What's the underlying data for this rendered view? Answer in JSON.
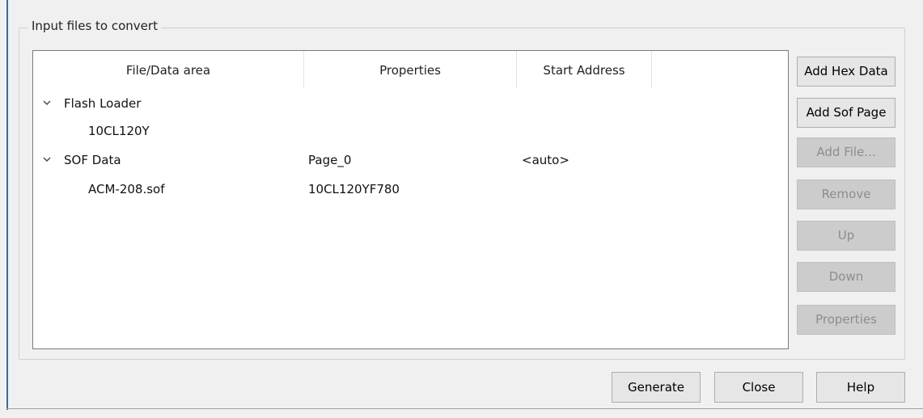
{
  "group": {
    "title": "Input files to convert"
  },
  "tree": {
    "columns": [
      "File/Data area",
      "Properties",
      "Start Address"
    ],
    "rows": [
      {
        "name": "Flash Loader",
        "properties": "",
        "start_address": "",
        "expander": "⌄",
        "level": 0
      },
      {
        "name": "10CL120Y",
        "properties": "",
        "start_address": "",
        "expander": "",
        "level": 1
      },
      {
        "name": "SOF Data",
        "properties": "Page_0",
        "start_address": "<auto>",
        "expander": "⌄",
        "level": 0
      },
      {
        "name": "ACM-208.sof",
        "properties": "10CL120YF780",
        "start_address": "",
        "expander": "",
        "level": 1
      }
    ]
  },
  "side_buttons": [
    {
      "label": "Add Hex Data",
      "enabled": true
    },
    {
      "label": "Add Sof Page",
      "enabled": true
    },
    {
      "label": "Add File...",
      "enabled": false
    },
    {
      "label": "Remove",
      "enabled": false
    },
    {
      "label": "Up",
      "enabled": false
    },
    {
      "label": "Down",
      "enabled": false
    },
    {
      "label": "Properties",
      "enabled": false
    }
  ],
  "bottom_buttons": {
    "generate": "Generate",
    "close": "Close",
    "help": "Help"
  },
  "icons": {
    "expander": "chevron-down-icon"
  },
  "colors": {
    "accent": "#2b6cb0",
    "disabled_button": "#cccccc",
    "disabled_text": "#8d8d8d"
  }
}
